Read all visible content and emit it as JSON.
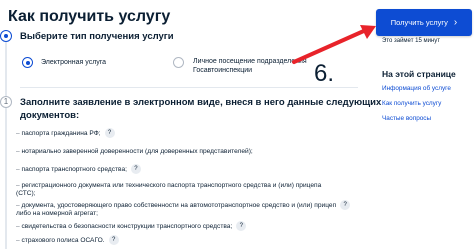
{
  "header": {
    "title": "Как получить услугу"
  },
  "step1": {
    "title": "Выберите тип получения услуги",
    "options": [
      {
        "label": "Электронная услуга",
        "selected": true
      },
      {
        "label_line1": "Личное посещение подразделения",
        "label_line2": "Госавтоинспекции",
        "selected": false
      }
    ]
  },
  "step2": {
    "number": "1",
    "title_line1": "Заполните заявление в электронном виде, внеся в него данные следующих",
    "title_line2": "документов:",
    "items": [
      {
        "line1": "паспорта гражданина РФ;",
        "help": true
      },
      {
        "line1": "нотариально заверенной доверенности (для доверенных представителей);",
        "help": false
      },
      {
        "line1": "паспорта транспортного средства;",
        "help": true
      },
      {
        "line1": "регистрационного документа или технического паспорта транспортного средства и (или) прицепа",
        "line2": "(СТС);",
        "help": false
      },
      {
        "line1": "документа, удостоверяющего право собственности на автомототранспортное средство и (или) прицеп",
        "line2": "либо на номерной агрегат;",
        "help": true
      },
      {
        "line1": "свидетельства о безопасности конструкции транспортного средства;",
        "help": true
      },
      {
        "line1": "страхового полиса ОСАГО.",
        "help": true
      }
    ]
  },
  "aside": {
    "button_label": "Получить услугу",
    "hint": "Это займет 15 минут",
    "title": "На этой странице",
    "links": [
      "Информация об услуге",
      "Как получить услугу",
      "Частые вопросы"
    ]
  },
  "annotation": {
    "number": "6."
  },
  "colors": {
    "accent": "#0d4cd3",
    "arrow": "#e8232a",
    "text": "#0b1f33"
  },
  "icons": {
    "help": "question-icon",
    "chevron": "chevron-right-icon"
  }
}
